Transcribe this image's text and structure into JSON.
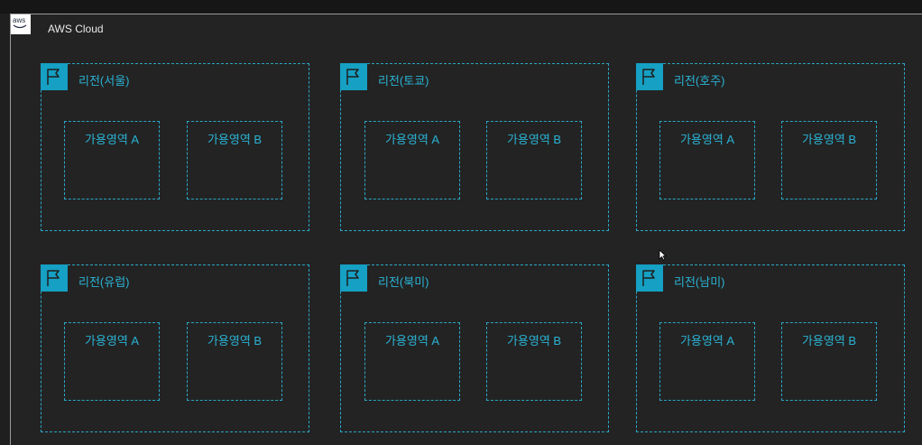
{
  "cloud": {
    "title": "AWS Cloud",
    "logo_text": "aws"
  },
  "regions": [
    {
      "label": "리전(서울)",
      "zones": [
        "가용영역 A",
        "가용영역 B"
      ]
    },
    {
      "label": "리전(토쿄)",
      "zones": [
        "가용영역 A",
        "가용영역 B"
      ]
    },
    {
      "label": "리전(호주)",
      "zones": [
        "가용영역 A",
        "가용영역 B"
      ]
    },
    {
      "label": "리전(유럽)",
      "zones": [
        "가용영역 A",
        "가용영역 B"
      ]
    },
    {
      "label": "리전(북미)",
      "zones": [
        "가용영역 A",
        "가용영역 B"
      ]
    },
    {
      "label": "리전(남미)",
      "zones": [
        "가용영역 A",
        "가용영역 B"
      ]
    }
  ],
  "colors": {
    "accent": "#15a0c4",
    "label": "#2ab3d4",
    "background": "#232323"
  },
  "icons": {
    "region": "flag-icon",
    "cloud": "aws-logo-icon"
  }
}
